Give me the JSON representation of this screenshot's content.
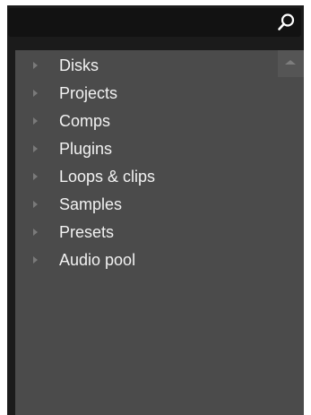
{
  "search": {
    "value": "",
    "placeholder": "",
    "icon": "search-icon"
  },
  "browser": {
    "items": [
      {
        "label": "Disks"
      },
      {
        "label": "Projects"
      },
      {
        "label": "Comps"
      },
      {
        "label": "Plugins"
      },
      {
        "label": "Loops & clips"
      },
      {
        "label": "Samples"
      },
      {
        "label": "Presets"
      },
      {
        "label": "Audio pool"
      }
    ]
  },
  "scrollbar": {
    "icon": "scroll-up-icon"
  },
  "colors": {
    "frame_background": "#1b1b1b",
    "panel_background": "#4b4b4b",
    "text": "#f2f2f2",
    "expander": "#7a7a7a"
  }
}
